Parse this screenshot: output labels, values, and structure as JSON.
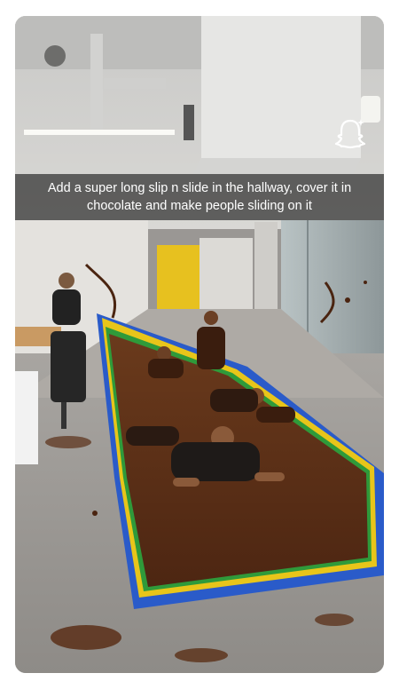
{
  "story": {
    "caption": "Add a super long slip n slide in the hallway, cover it in chocolate and make people sliding on it",
    "badge_icon": "snapchat-ghost-icon"
  },
  "colors": {
    "chocolate": "#5a2f17",
    "slide_blue": "#2a5bc9",
    "slide_yellow": "#e8c51a",
    "slide_green": "#2f9a3a",
    "wall_yellow": "#e7c11f",
    "caption_bar": "rgba(20,20,20,0.62)"
  }
}
